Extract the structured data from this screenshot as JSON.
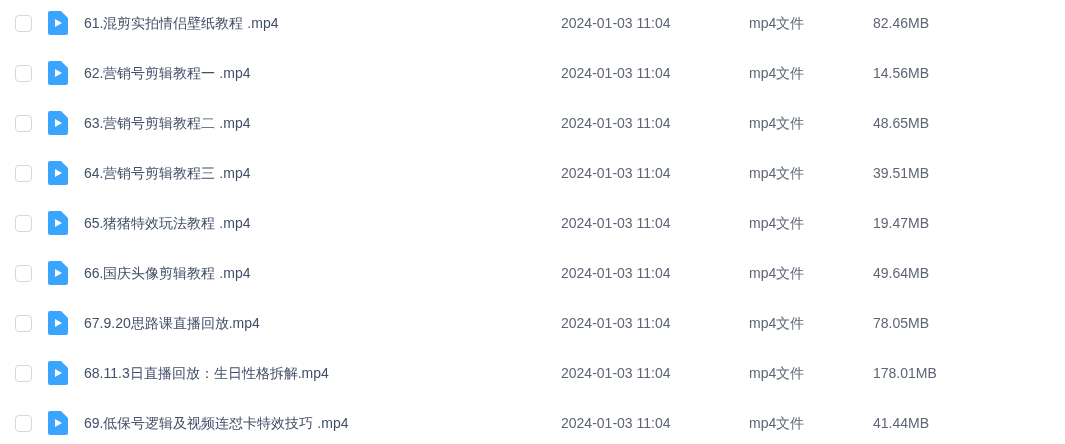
{
  "files": [
    {
      "name": "61.混剪实拍情侣壁纸教程 .mp4",
      "date": "2024-01-03 11:04",
      "type": "mp4文件",
      "size": "82.46MB",
      "checked": false
    },
    {
      "name": "62.营销号剪辑教程一 .mp4",
      "date": "2024-01-03 11:04",
      "type": "mp4文件",
      "size": "14.56MB",
      "checked": false
    },
    {
      "name": "63.营销号剪辑教程二 .mp4",
      "date": "2024-01-03 11:04",
      "type": "mp4文件",
      "size": "48.65MB",
      "checked": false
    },
    {
      "name": "64.营销号剪辑教程三 .mp4",
      "date": "2024-01-03 11:04",
      "type": "mp4文件",
      "size": "39.51MB",
      "checked": false
    },
    {
      "name": "65.猪猪特效玩法教程 .mp4",
      "date": "2024-01-03 11:04",
      "type": "mp4文件",
      "size": "19.47MB",
      "checked": false
    },
    {
      "name": "66.国庆头像剪辑教程 .mp4",
      "date": "2024-01-03 11:04",
      "type": "mp4文件",
      "size": "49.64MB",
      "checked": false
    },
    {
      "name": "67.9.20思路课直播回放.mp4",
      "date": "2024-01-03 11:04",
      "type": "mp4文件",
      "size": "78.05MB",
      "checked": false
    },
    {
      "name": "68.11.3日直播回放：生日性格拆解.mp4",
      "date": "2024-01-03 11:04",
      "type": "mp4文件",
      "size": "178.01MB",
      "checked": false
    },
    {
      "name": "69.低保号逻辑及视频连怼卡特效技巧 .mp4",
      "date": "2024-01-03 11:04",
      "type": "mp4文件",
      "size": "41.44MB",
      "checked": false
    }
  ]
}
